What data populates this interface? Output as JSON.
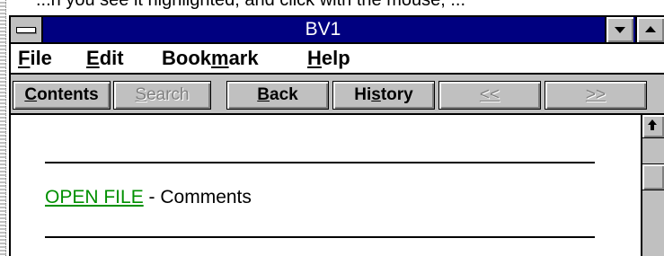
{
  "window": {
    "title": "BV1"
  },
  "top_snippet": "...n you see it highlighted, and click with the mouse, ...",
  "menu": {
    "items": [
      {
        "accel": "F",
        "rest": "ile"
      },
      {
        "accel": "E",
        "rest": "dit"
      },
      {
        "pre": "Book",
        "accel": "m",
        "rest": "ark"
      },
      {
        "accel": "H",
        "rest": "elp"
      }
    ]
  },
  "toolbar": {
    "contents": {
      "accel": "C",
      "rest": "ontents"
    },
    "search": {
      "accel": "S",
      "rest": "earch"
    },
    "back": {
      "accel": "B",
      "rest": "ack"
    },
    "history": {
      "pre": "Hi",
      "accel": "s",
      "rest": "tory"
    },
    "prev": "<<",
    "next": ">>"
  },
  "content": {
    "entry_link": "OPEN FILE",
    "entry_desc": " - Comments"
  },
  "colors": {
    "titlebar": "#000080",
    "link": "#009000",
    "face": "#c0c0c0"
  },
  "icons": {
    "system_menu": "system-menu-icon",
    "minimize": "minimize-arrow-icon",
    "maximize": "maximize-arrow-icon",
    "scroll_up": "scroll-up-arrow-icon"
  }
}
